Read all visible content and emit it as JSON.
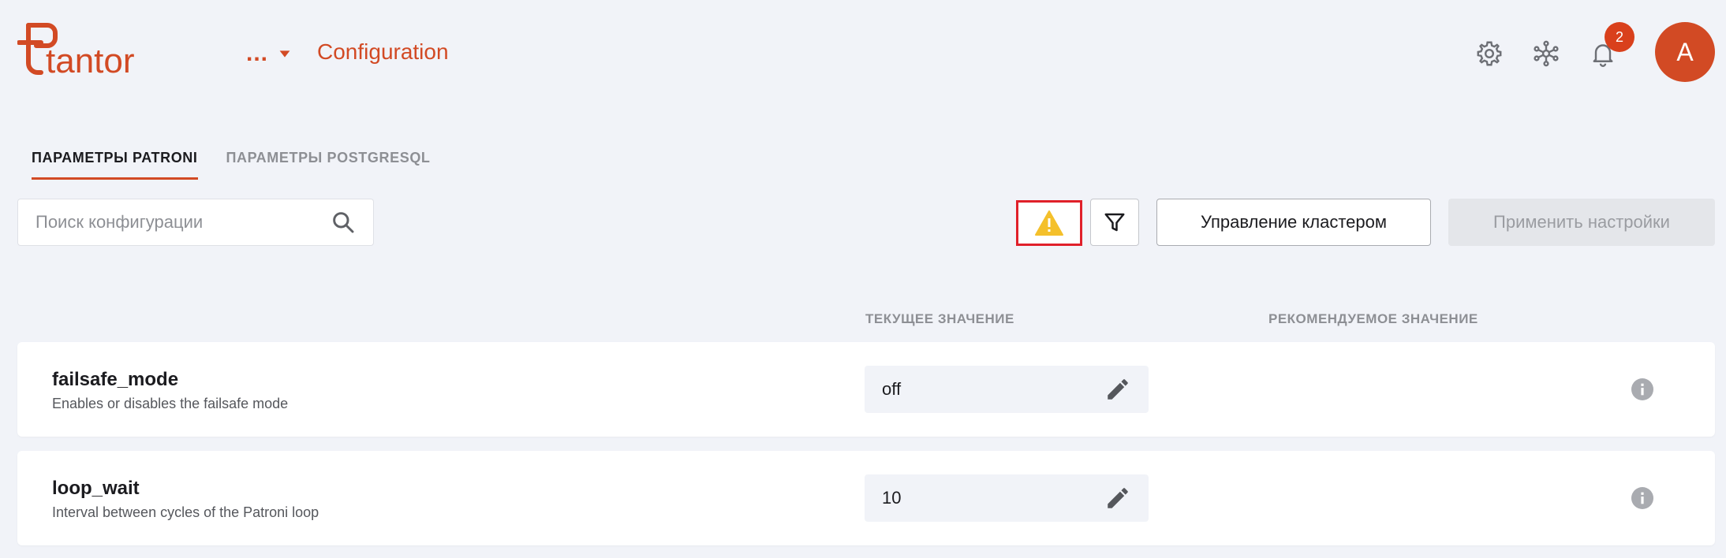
{
  "app": {
    "logo_text": "tantor",
    "brand_color": "#d24a24",
    "breadcrumb_more": "...",
    "page_title": "Configuration"
  },
  "header_icons": {
    "settings": "gear-icon",
    "topology": "network-icon",
    "notifications": "bell-icon",
    "notification_count": "2",
    "avatar_letter": "A"
  },
  "tabs": [
    {
      "label": "ПАРАМЕТРЫ PATRONI",
      "active": true
    },
    {
      "label": "ПАРАМЕТРЫ POSTGRESQL",
      "active": false
    }
  ],
  "toolbar": {
    "search_placeholder": "Поиск конфигурации",
    "warning_icon": "warning-icon",
    "filter_icon": "filter-icon",
    "cluster_button": "Управление кластером",
    "apply_button": "Применить настройки"
  },
  "columns": {
    "current": "ТЕКУЩЕЕ ЗНАЧЕНИЕ",
    "recommended": "РЕКОМЕНДУЕМОЕ ЗНАЧЕНИЕ"
  },
  "parameters": [
    {
      "name": "failsafe_mode",
      "description": "Enables or disables the failsafe mode",
      "value": "off"
    },
    {
      "name": "loop_wait",
      "description": "Interval between cycles of the Patroni loop",
      "value": "10"
    }
  ]
}
